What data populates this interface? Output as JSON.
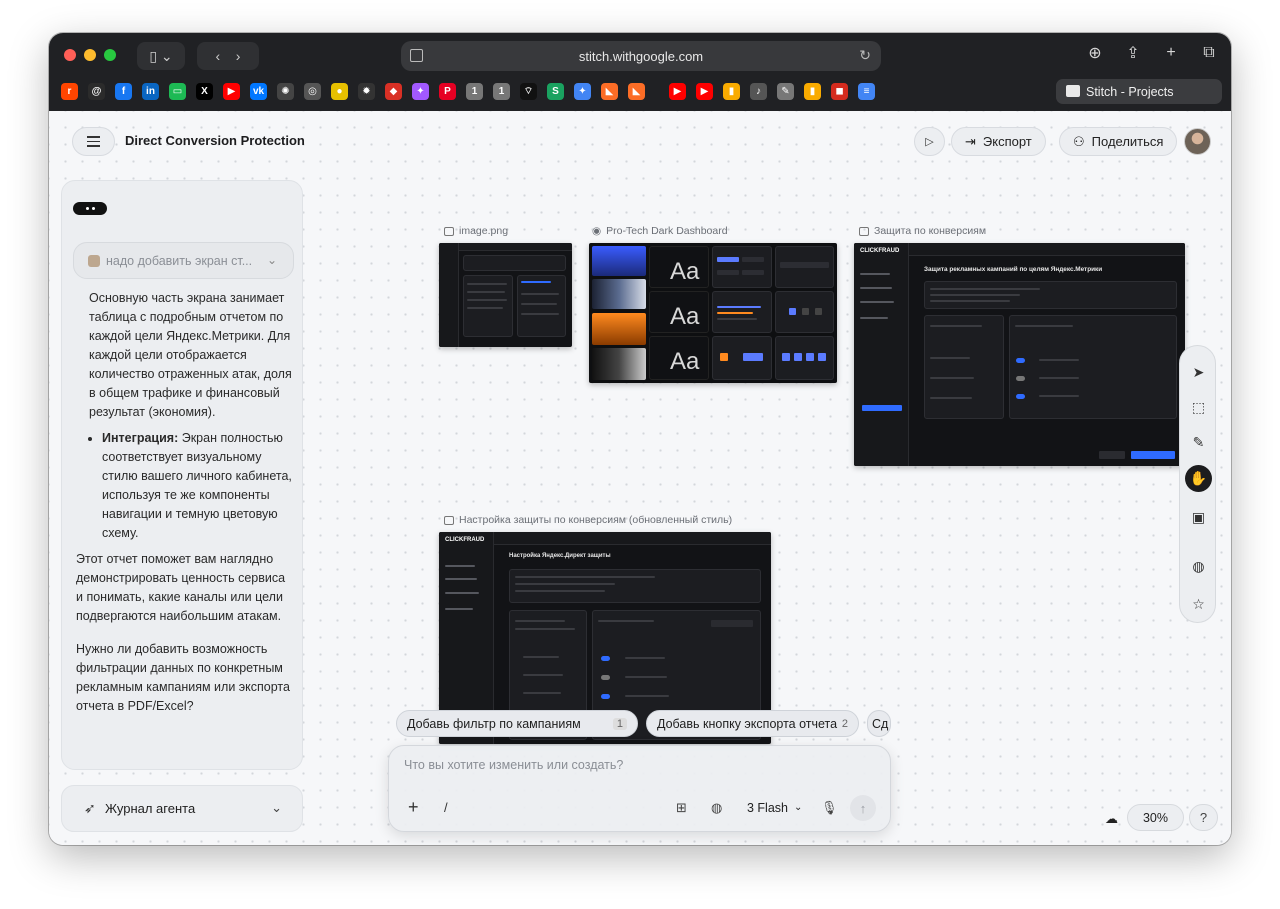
{
  "browser": {
    "url": "stitch.withgoogle.com",
    "active_tab_title": "Stitch - Projects",
    "favicons": [
      {
        "name": "reddit-icon",
        "color": "#ff4500",
        "glyph": "r"
      },
      {
        "name": "threads-icon",
        "color": "#2b2b2b",
        "glyph": "@"
      },
      {
        "name": "facebook-icon",
        "color": "#1877f2",
        "glyph": "f"
      },
      {
        "name": "linkedin-icon",
        "color": "#0a66c2",
        "glyph": "in"
      },
      {
        "name": "green-app-icon",
        "color": "#1db954",
        "glyph": "▭"
      },
      {
        "name": "x-icon",
        "color": "#000000",
        "glyph": "X"
      },
      {
        "name": "youtube-icon",
        "color": "#ff0000",
        "glyph": "▶"
      },
      {
        "name": "vk-icon",
        "color": "#0077ff",
        "glyph": "vk"
      },
      {
        "name": "openai-icon",
        "color": "#444444",
        "glyph": "✺"
      },
      {
        "name": "compass-icon",
        "color": "#555555",
        "glyph": "◎"
      },
      {
        "name": "yellow-app-icon",
        "color": "#e7c000",
        "glyph": "●"
      },
      {
        "name": "gear-app-icon",
        "color": "#333333",
        "glyph": "✹"
      },
      {
        "name": "red-app-icon",
        "color": "#d93025",
        "glyph": "◆"
      },
      {
        "name": "figma-icon",
        "color": "#a259ff",
        "glyph": "✦"
      },
      {
        "name": "pinterest-icon",
        "color": "#e60023",
        "glyph": "P"
      },
      {
        "name": "one-icon-a",
        "color": "#777777",
        "glyph": "1"
      },
      {
        "name": "one-icon-b",
        "color": "#777777",
        "glyph": "1"
      },
      {
        "name": "wifi-app-icon",
        "color": "#111111",
        "glyph": "⌔"
      },
      {
        "name": "s-app-icon",
        "color": "#1aa260",
        "glyph": "S"
      },
      {
        "name": "gemini-icon",
        "color": "#4285f4",
        "glyph": "✦"
      },
      {
        "name": "gitlab-icon-a",
        "color": "#fc6d26",
        "glyph": "◣"
      },
      {
        "name": "gitlab-icon-b",
        "color": "#fc6d26",
        "glyph": "◣"
      },
      {
        "name": "youtube-icon-b",
        "color": "#ff0000",
        "glyph": "▶"
      },
      {
        "name": "youtube-icon-c",
        "color": "#ff0000",
        "glyph": "▶"
      },
      {
        "name": "analytics-icon-a",
        "color": "#f9ab00",
        "glyph": "▮"
      },
      {
        "name": "mic-app-icon",
        "color": "#555555",
        "glyph": "♪"
      },
      {
        "name": "tool-app-icon",
        "color": "#777777",
        "glyph": "✎"
      },
      {
        "name": "analytics-icon-b",
        "color": "#f9ab00",
        "glyph": "▮"
      },
      {
        "name": "flag-icon",
        "color": "#d52b1e",
        "glyph": "◼"
      },
      {
        "name": "stripe-icon",
        "color": "#4285f4",
        "glyph": "≡"
      }
    ]
  },
  "header": {
    "project_title": "Direct Conversion Protection",
    "export_label": "Экспорт",
    "share_label": "Поделиться"
  },
  "chat": {
    "prompt_preview": "надо добавить экран ст...",
    "para1": "Основную часть экрана занимает таблица с подробным отчетом по каждой цели Яндекс.Метрики. Для каждой цели отображается количество отраженных атак, доля в общем трафике и финансовый результат (экономия).",
    "bullet_label": "Интеграция:",
    "bullet_text": " Экран полностью соответствует визуальному стилю вашего личного кабинета, используя те же компоненты навигации и темную цветовую схему.",
    "para2": "Этот отчет поможет вам наглядно демонстрировать ценность сервиса и понимать, какие каналы или цели подвергаются наибольшим атакам.",
    "para3": "Нужно ли добавить возможность фильтрации данных по конкретным рекламным кампаниям или экспорта отчета в PDF/Excel?"
  },
  "agent_journal": {
    "label": "Журнал агента"
  },
  "canvas": {
    "frames": [
      {
        "label": "image.png"
      },
      {
        "label": "Pro-Tech Dark Dashboard"
      },
      {
        "label": "Защита по конверсиям"
      },
      {
        "label": "Настройка защиты по конверсиям (обновленный стиль)"
      }
    ],
    "style_sheet": {
      "aa": "Aa"
    },
    "mock_conversion": {
      "logo": "CLICKFRAUD",
      "title": "Защита рекламных кампаний по целям Яндекс.Метрики"
    },
    "mock_settings": {
      "logo": "CLICKFRAUD",
      "title": "Настройка Яндекс.Директ защиты"
    }
  },
  "suggestions": [
    {
      "label": "Добавь фильтр по кампаниям",
      "count": "1"
    },
    {
      "label": "Добавь кнопку экспорта отчета",
      "count": "2"
    },
    {
      "label": "Сд"
    }
  ],
  "composer": {
    "placeholder": "Что вы хотите изменить или создать?",
    "slash": "/",
    "model": "3 Flash"
  },
  "zoom": {
    "level": "30%"
  },
  "help": {
    "label": "?"
  }
}
